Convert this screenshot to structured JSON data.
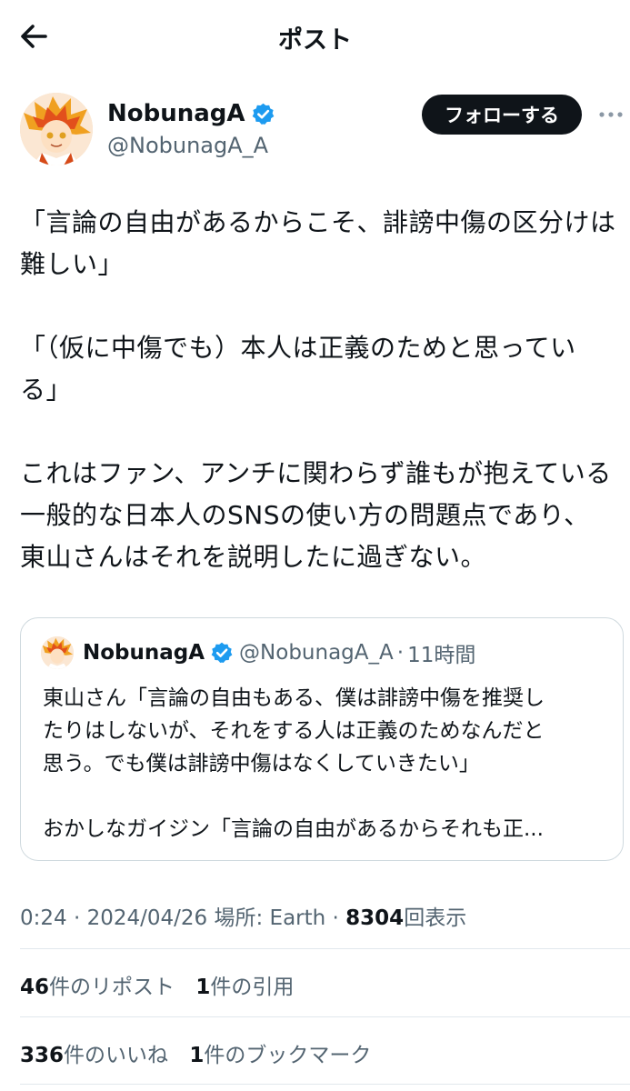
{
  "header": {
    "title": "ポスト"
  },
  "author": {
    "name": "NobunagA",
    "handle": "@NobunagA_A",
    "follow_label": "フォローする"
  },
  "post": {
    "paragraphs": [
      [
        "「言論の自由があるからこそ、誹謗中傷の区分けは",
        "難しい」"
      ],
      [
        "「（仮に中傷でも）本人は正義のためと思ってい",
        "る」"
      ],
      [
        "これはファン、アンチに関わらず誰もが抱えている",
        "一般的な日本人のSNSの使い方の問題点であり、",
        "東山さんはそれを説明したに過ぎない。"
      ]
    ]
  },
  "quote": {
    "name": "NobunagA",
    "handle": "@NobunagA_A",
    "separator": "·",
    "time": "11時間",
    "lines": [
      "東山さん「言論の自由もある、僕は誹謗中傷を推奨し",
      "たりはしないが、それをする人は正義のためなんだと",
      "思う。でも僕は誹謗中傷はなくしていきたい」"
    ],
    "truncated_line": "おかしなガイジン「言論の自由があるからそれも正..."
  },
  "meta": {
    "time": "0:24",
    "date": "2024/04/26",
    "location": "場所: Earth",
    "sep": "·",
    "views": "8304",
    "views_label": "回表示"
  },
  "stats": {
    "reposts": "46",
    "reposts_label": "件のリポスト",
    "quotes": "1",
    "quotes_label": "件の引用",
    "likes": "336",
    "likes_label": "件のいいね",
    "bookmarks": "1",
    "bookmarks_label": "件のブックマーク"
  },
  "colors": {
    "text": "#0f1419",
    "secondary": "#536471",
    "verified": "#1d9bf0",
    "border": "#cfd9de"
  },
  "icons": {
    "back": "arrow-left-icon",
    "verified": "verified-badge-icon",
    "more": "more-icon"
  }
}
